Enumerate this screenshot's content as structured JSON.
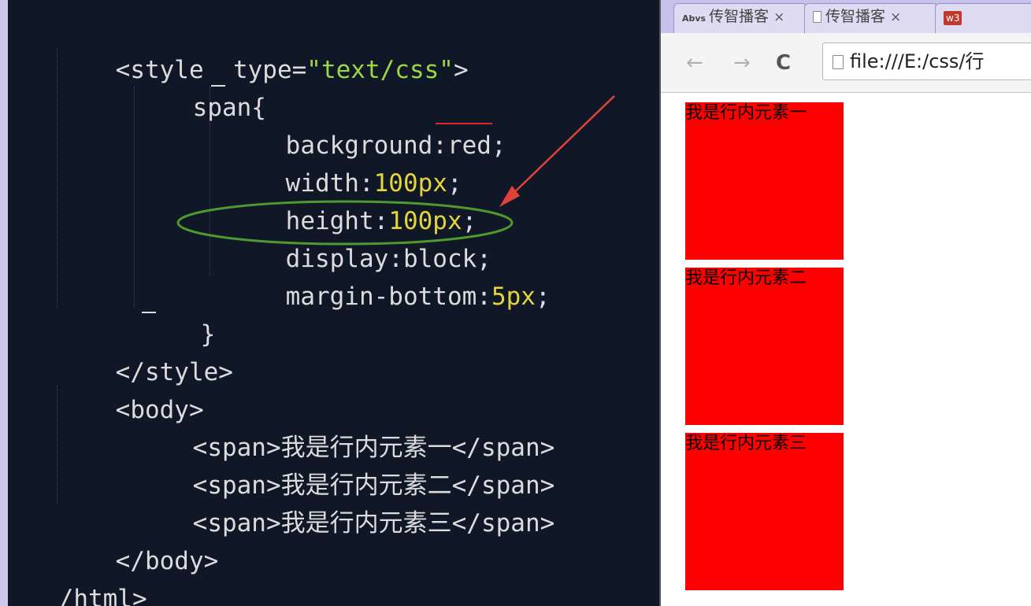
{
  "editor": {
    "lines": {
      "style_open_a": "<style  type=",
      "style_open_b": "\"text/css\"",
      "style_open_c": ">",
      "span_sel": "span{",
      "bg_a": "background:",
      "bg_b": "red",
      "bg_c": ";",
      "w_a": "width:",
      "w_b": "100px",
      "w_c": ";",
      "h_a": "height:",
      "h_b": "100px",
      "h_c": ";",
      "display": "display:block;",
      "mb_a": "margin-bottom:",
      "mb_b": "5px",
      "mb_c": ";",
      "close_brace": "}",
      "style_close": "</style>",
      "body_open": "<body>",
      "span1": "<span>我是行内元素一</span>",
      "span2": "<span>我是行内元素二</span>",
      "span3": "<span>我是行内元素三</span>",
      "body_close": "</body>",
      "html_close": "/html>"
    }
  },
  "browser": {
    "tabs": [
      {
        "favicon": "Abvs",
        "title": "传智播客",
        "close": "×"
      },
      {
        "favicon": "page-icon",
        "title": "传智播客",
        "close": "×"
      },
      {
        "favicon": "w3",
        "title": ""
      }
    ],
    "address": "file:///E:/css/行",
    "nav": {
      "back": "←",
      "forward": "→",
      "reload": "C"
    },
    "spans": [
      "我是行内元素一",
      "我是行内元素二",
      "我是行内元素三"
    ]
  },
  "annotation_colors": {
    "arrow": "#e0423a",
    "ellipse": "#4f9a2e"
  }
}
